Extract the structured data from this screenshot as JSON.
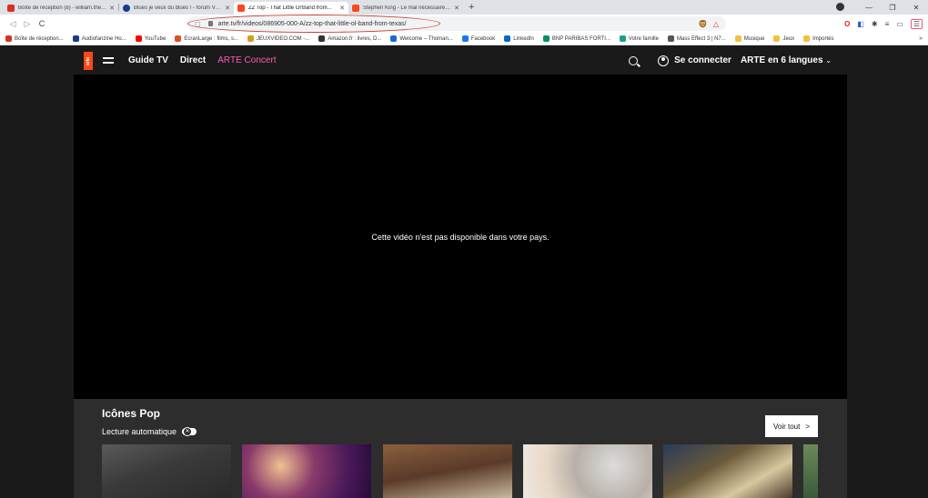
{
  "browser": {
    "tabs": [
      {
        "title": "Boîte de réception (8) - william.thebu...",
        "favicon_color": "#d93025",
        "active": false
      },
      {
        "title": "Blues je veux du blues ! - forum Vox d...",
        "favicon_color": "#1a3a8a",
        "active": false
      },
      {
        "title": "ZZ Top - That Little Ol'Band from...",
        "favicon_color": "#fa481c",
        "active": true
      },
      {
        "title": "Stephen King - Le mal nécessaire - Re...",
        "favicon_color": "#fa481c",
        "active": false
      }
    ],
    "new_tab": "+",
    "window_controls": {
      "minimize": "—",
      "restore": "❐",
      "close": "✕"
    },
    "toolbar": {
      "back": "◁",
      "forward": "▷",
      "reload": "C"
    },
    "url": "arte.tv/fr/videos/086905-000-A/zz-top-that-little-ol-band-from-texas/",
    "extensions": {
      "brave_shield": "🦁",
      "rewards": "△"
    },
    "toolbar_right": [
      "O",
      "◧",
      "✱",
      "≡",
      "▭",
      "☰"
    ],
    "bookmarks": [
      {
        "label": "Boîte de réception...",
        "color": "#d93025"
      },
      {
        "label": "Audiofanzine Ho...",
        "color": "#1a3a8a"
      },
      {
        "label": "YouTube",
        "color": "#ff0000"
      },
      {
        "label": "EcranLarge : films, s...",
        "color": "#e05020"
      },
      {
        "label": "JEUXVIDEO.COM -...",
        "color": "#d0a020"
      },
      {
        "label": "Amazon.fr : livres, D...",
        "color": "#333333"
      },
      {
        "label": "Welcome – Thoman...",
        "color": "#1a6ad0"
      },
      {
        "label": "Facebook",
        "color": "#1877f2"
      },
      {
        "label": "LinkedIn",
        "color": "#0a66c2"
      },
      {
        "label": "BNP PARIBAS FORTI...",
        "color": "#00915a"
      },
      {
        "label": "Votre famille",
        "color": "#1aa08a"
      },
      {
        "label": "Mass Effect 3 | N7...",
        "color": "#555555"
      },
      {
        "label": "Musique",
        "color": "#f0c040"
      },
      {
        "label": "Jeux",
        "color": "#f0c040"
      },
      {
        "label": "Importés",
        "color": "#f0c040"
      }
    ],
    "bookmarks_more": "»"
  },
  "arte": {
    "logo_text": "arte",
    "nav": {
      "guide_tv": "Guide TV",
      "direct": "Direct",
      "concert": "ARTE Concert",
      "login": "Se connecter",
      "languages": "ARTE en 6 langues",
      "lang_chevron": "⌄"
    },
    "player": {
      "message": "Cette vidéo n'est pas disponible dans votre pays."
    },
    "rail": {
      "title": "Icônes Pop",
      "autoplay_label": "Lecture automatique",
      "see_all": "Voir tout",
      "see_all_arrow": ">"
    }
  }
}
